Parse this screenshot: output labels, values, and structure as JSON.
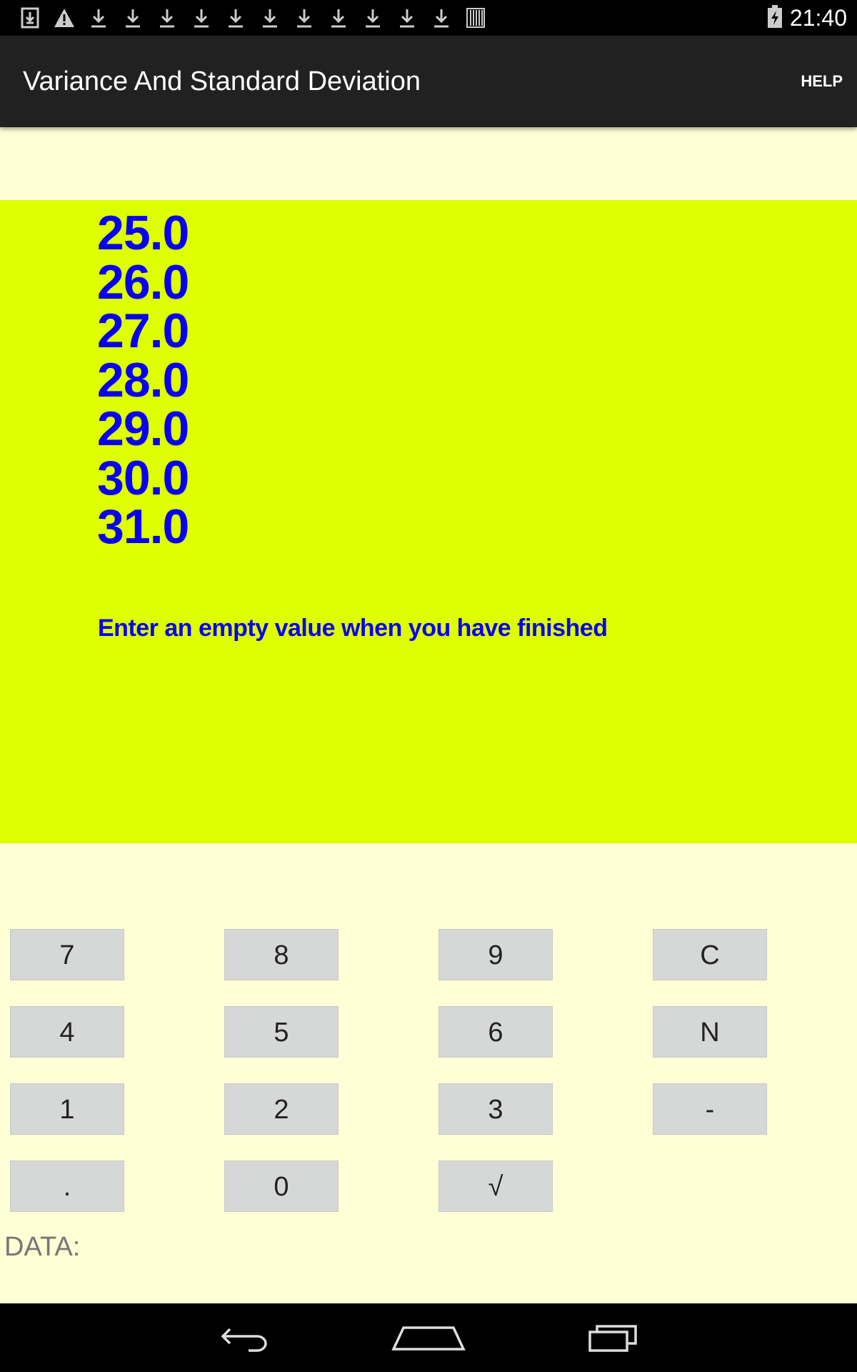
{
  "status_bar": {
    "time": "21:40",
    "notification_icons": [
      "download-done-icon",
      "warning-icon",
      "download-icon",
      "download-icon",
      "download-icon",
      "download-icon",
      "download-icon",
      "download-icon",
      "download-icon",
      "download-icon",
      "download-icon",
      "download-icon",
      "download-icon",
      "barcode-icon"
    ],
    "battery_icon": "battery-charging-icon"
  },
  "app_bar": {
    "title": "Variance And Standard Deviation",
    "help_label": "HELP"
  },
  "colors": {
    "panel_bg": "#deff00",
    "text_blue": "#0a00f0",
    "page_bg": "#ffffd6",
    "key_bg": "#d6d7d7"
  },
  "data_panel": {
    "values": [
      "25.0",
      "26.0",
      "27.0",
      "28.0",
      "29.0",
      "30.0",
      "31.0"
    ],
    "hint": "Enter an empty value when you have finished"
  },
  "keypad": {
    "rows": [
      [
        "7",
        "8",
        "9",
        "C"
      ],
      [
        "4",
        "5",
        "6",
        "N"
      ],
      [
        "1",
        "2",
        "3",
        "-"
      ],
      [
        ".",
        "0",
        "√"
      ]
    ]
  },
  "data_field": {
    "label": "DATA:",
    "value": ""
  },
  "nav_bar": {
    "buttons": [
      "back-icon",
      "home-icon",
      "recent-apps-icon"
    ]
  }
}
